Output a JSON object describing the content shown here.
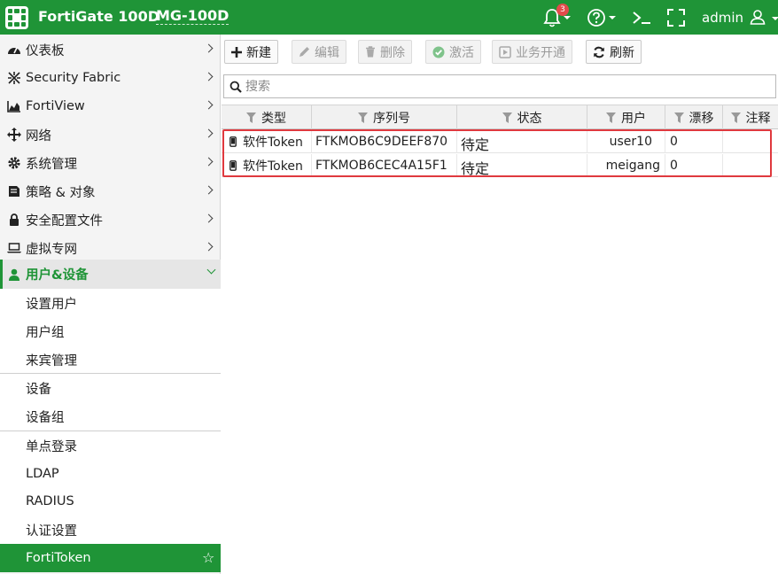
{
  "header": {
    "product": "FortiGate 100D",
    "hostname": "MG-100D",
    "notification_count": "3",
    "user": "admin",
    "bg_color": "#1f9437"
  },
  "sidebar": {
    "items": [
      {
        "label": "仪表板",
        "icon": "dashboard-icon"
      },
      {
        "label": "Security Fabric",
        "icon": "fabric-icon"
      },
      {
        "label": "FortiView",
        "icon": "chart-icon"
      },
      {
        "label": "网络",
        "icon": "network-icon"
      },
      {
        "label": "系统管理",
        "icon": "gear-icon"
      },
      {
        "label": "策略 & 对象",
        "icon": "policy-icon"
      },
      {
        "label": "安全配置文件",
        "icon": "lock-icon"
      },
      {
        "label": "虚拟专网",
        "icon": "laptop-icon"
      },
      {
        "label": "用户&设备",
        "icon": "user-icon"
      }
    ],
    "subitems": [
      "设置用户",
      "用户组",
      "来宾管理",
      "设备",
      "设备组",
      "单点登录",
      "LDAP",
      "RADIUS",
      "认证设置",
      "FortiToken"
    ]
  },
  "toolbar": {
    "new": "新建",
    "edit": "编辑",
    "delete": "删除",
    "activate": "激活",
    "provision": "业务开通",
    "refresh": "刷新"
  },
  "search": {
    "placeholder": "搜索",
    "value": ""
  },
  "table": {
    "columns": [
      "类型",
      "序列号",
      "状态",
      "用户",
      "漂移",
      "注释"
    ],
    "rows": [
      {
        "type": "软件Token",
        "serial": "FTKMOB6C9DEEF870",
        "status": "待定",
        "user": "user10",
        "drift": "0",
        "comment": ""
      },
      {
        "type": "软件Token",
        "serial": "FTKMOB6CEC4A15F1",
        "status": "待定",
        "user": "meigang",
        "drift": "0",
        "comment": ""
      }
    ]
  }
}
